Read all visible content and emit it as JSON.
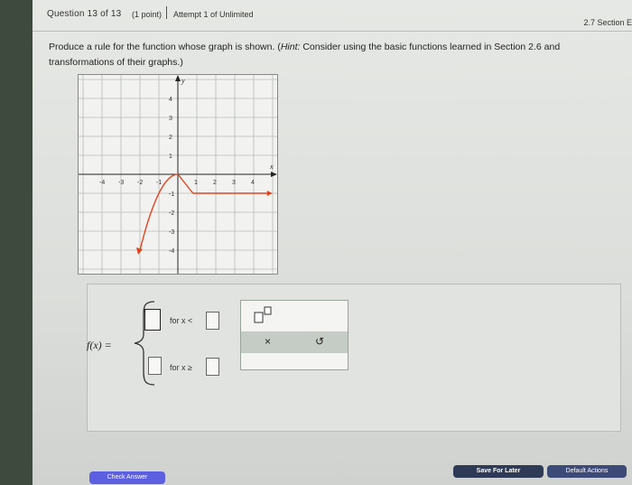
{
  "header": {
    "question": "Question 13 of 13",
    "points": "(1 point)",
    "attempt": "Attempt 1 of Unlimited",
    "section": "2.7 Section E"
  },
  "prompt": {
    "main": "Produce a rule for the function whose graph is shown. (",
    "hint_label": "Hint:",
    "hint": " Consider using the basic functions learned in Section 2.6 and transformations of their graphs.)"
  },
  "graph": {
    "axis_x_label": "x",
    "axis_y_label": "y",
    "x_ticks": [
      "-4",
      "-3",
      "-2",
      "-1",
      "1",
      "2",
      "3",
      "4"
    ],
    "y_ticks": [
      "4",
      "3",
      "2",
      "1",
      "-1",
      "-2",
      "-3",
      "-4"
    ],
    "curve_color": "#e0441f"
  },
  "answer": {
    "fx": "f(x) =",
    "cond1": "for x <",
    "cond2": "for x ≥"
  },
  "palette": {
    "multiply": "×",
    "undo": "↺"
  },
  "buttons": {
    "check": "Check Answer",
    "save": "Save For Later",
    "default": "Default Actions"
  }
}
